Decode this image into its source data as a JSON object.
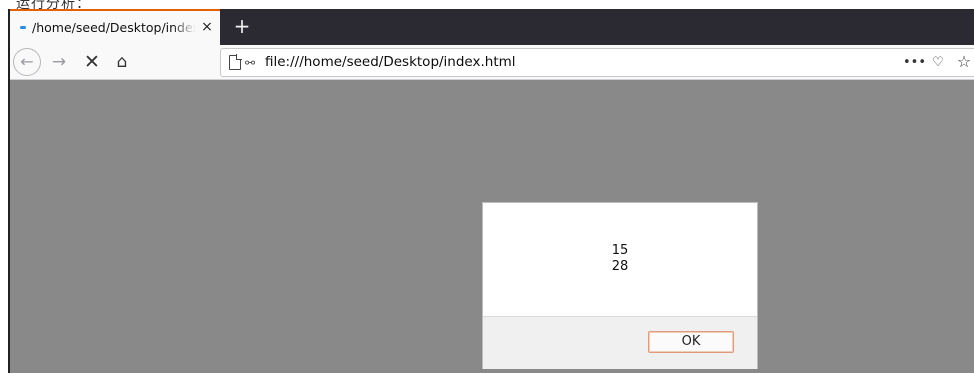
{
  "top_strip_text": "运行分析：",
  "tab": {
    "title": "/home/seed/Desktop/index.html",
    "close_glyph": "×",
    "new_tab_glyph": "+"
  },
  "nav": {
    "back_glyph": "←",
    "forward_glyph": "→",
    "stop_glyph": "✕",
    "home_glyph": "⌂",
    "url": "file:///home/seed/Desktop/index.html",
    "page_actions_glyph": "•••",
    "pocket_glyph": "♡",
    "bookmark_glyph": "☆",
    "perm_glyph": "⚯"
  },
  "dialog": {
    "lines": [
      "15",
      "28"
    ],
    "ok_label": "OK"
  },
  "colors": {
    "tabbar": "#2b2a33",
    "tab_accent": "#e66000",
    "content_bg": "#898989",
    "dialog_footer": "#f0f0f0"
  }
}
